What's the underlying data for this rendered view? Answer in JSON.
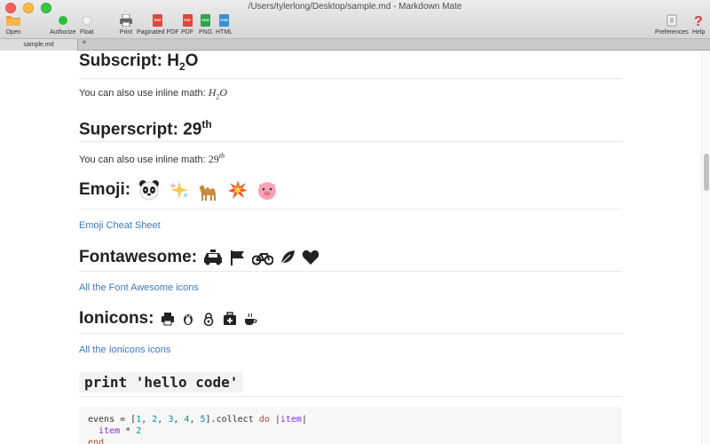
{
  "window": {
    "title": "/Users/tylerlong/Desktop/sample.md - Markdown Mate",
    "traffic_colors": [
      "#fc605c",
      "#fdbc40",
      "#34c84a"
    ]
  },
  "toolbar": {
    "open": "Open",
    "authorize": "Authorize",
    "float": "Float",
    "print": "Print",
    "paginated_pdf": "Paginated PDF",
    "pdf": "PDF",
    "png": "PNG",
    "html": "HTML",
    "preferences": "Preferences",
    "help": "Help",
    "icons": {
      "open": "folder-icon",
      "authorize": "green-dot-icon",
      "float": "grey-dot-icon",
      "print": "printer-icon",
      "paginated_pdf": "pdf-file-icon",
      "pdf": "pdf-file-icon",
      "png": "png-file-icon",
      "html": "html-file-icon",
      "preferences": "switch-icon",
      "help": "question-mark-icon"
    },
    "colors": {
      "pdf": "#e0473c",
      "png": "#2ea44f",
      "html": "#3a8fd6",
      "authorize": "#2dbe3a",
      "help": "#d23b3b"
    }
  },
  "tabs": {
    "active": "sample.md",
    "add": "+"
  },
  "doc": {
    "subscript_heading": "Subscript: H",
    "subscript_sub": "2",
    "subscript_tail": "O",
    "subscript_para": "You can also use inline math: ",
    "subscript_math_base": "H",
    "subscript_math_sub": "2",
    "subscript_math_tail": "O",
    "superscript_heading": "Superscript: 29",
    "superscript_sup": "th",
    "superscript_para": "You can also use inline math: ",
    "superscript_math_base": "29",
    "superscript_math_sup": "th",
    "emoji_heading": "Emoji:",
    "emoji_list": [
      "panda-face",
      "sparkles",
      "camel",
      "boom",
      "pig-face"
    ],
    "emoji_link": "Emoji Cheat Sheet",
    "fontawesome_heading": "Fontawesome:",
    "fontawesome_icons": [
      "taxi-icon",
      "flag-icon",
      "bicycle-icon",
      "leaf-icon",
      "heart-icon"
    ],
    "fontawesome_link": "All the Font Awesome icons",
    "ionicons_heading": "Ionicons:",
    "ionicons_icons": [
      "printer-icon",
      "tux-icon",
      "lock-icon",
      "medkit-icon",
      "coffee-icon"
    ],
    "ionicons_link": "All the Ionicons icons",
    "code_heading": "print 'hello code'",
    "code_line1_a": "evens = [",
    "code_line1_nums": [
      "1",
      "2",
      "3",
      "4",
      "5"
    ],
    "code_line1_b": "].collect ",
    "code_line1_do": "do",
    "code_line1_pipe": " |",
    "code_line1_item": "item",
    "code_line1_end": "|",
    "code_line2_item": "item",
    "code_line2_op": " * ",
    "code_line2_num": "2",
    "code_line3": "end",
    "link_color": "#4078c0"
  }
}
